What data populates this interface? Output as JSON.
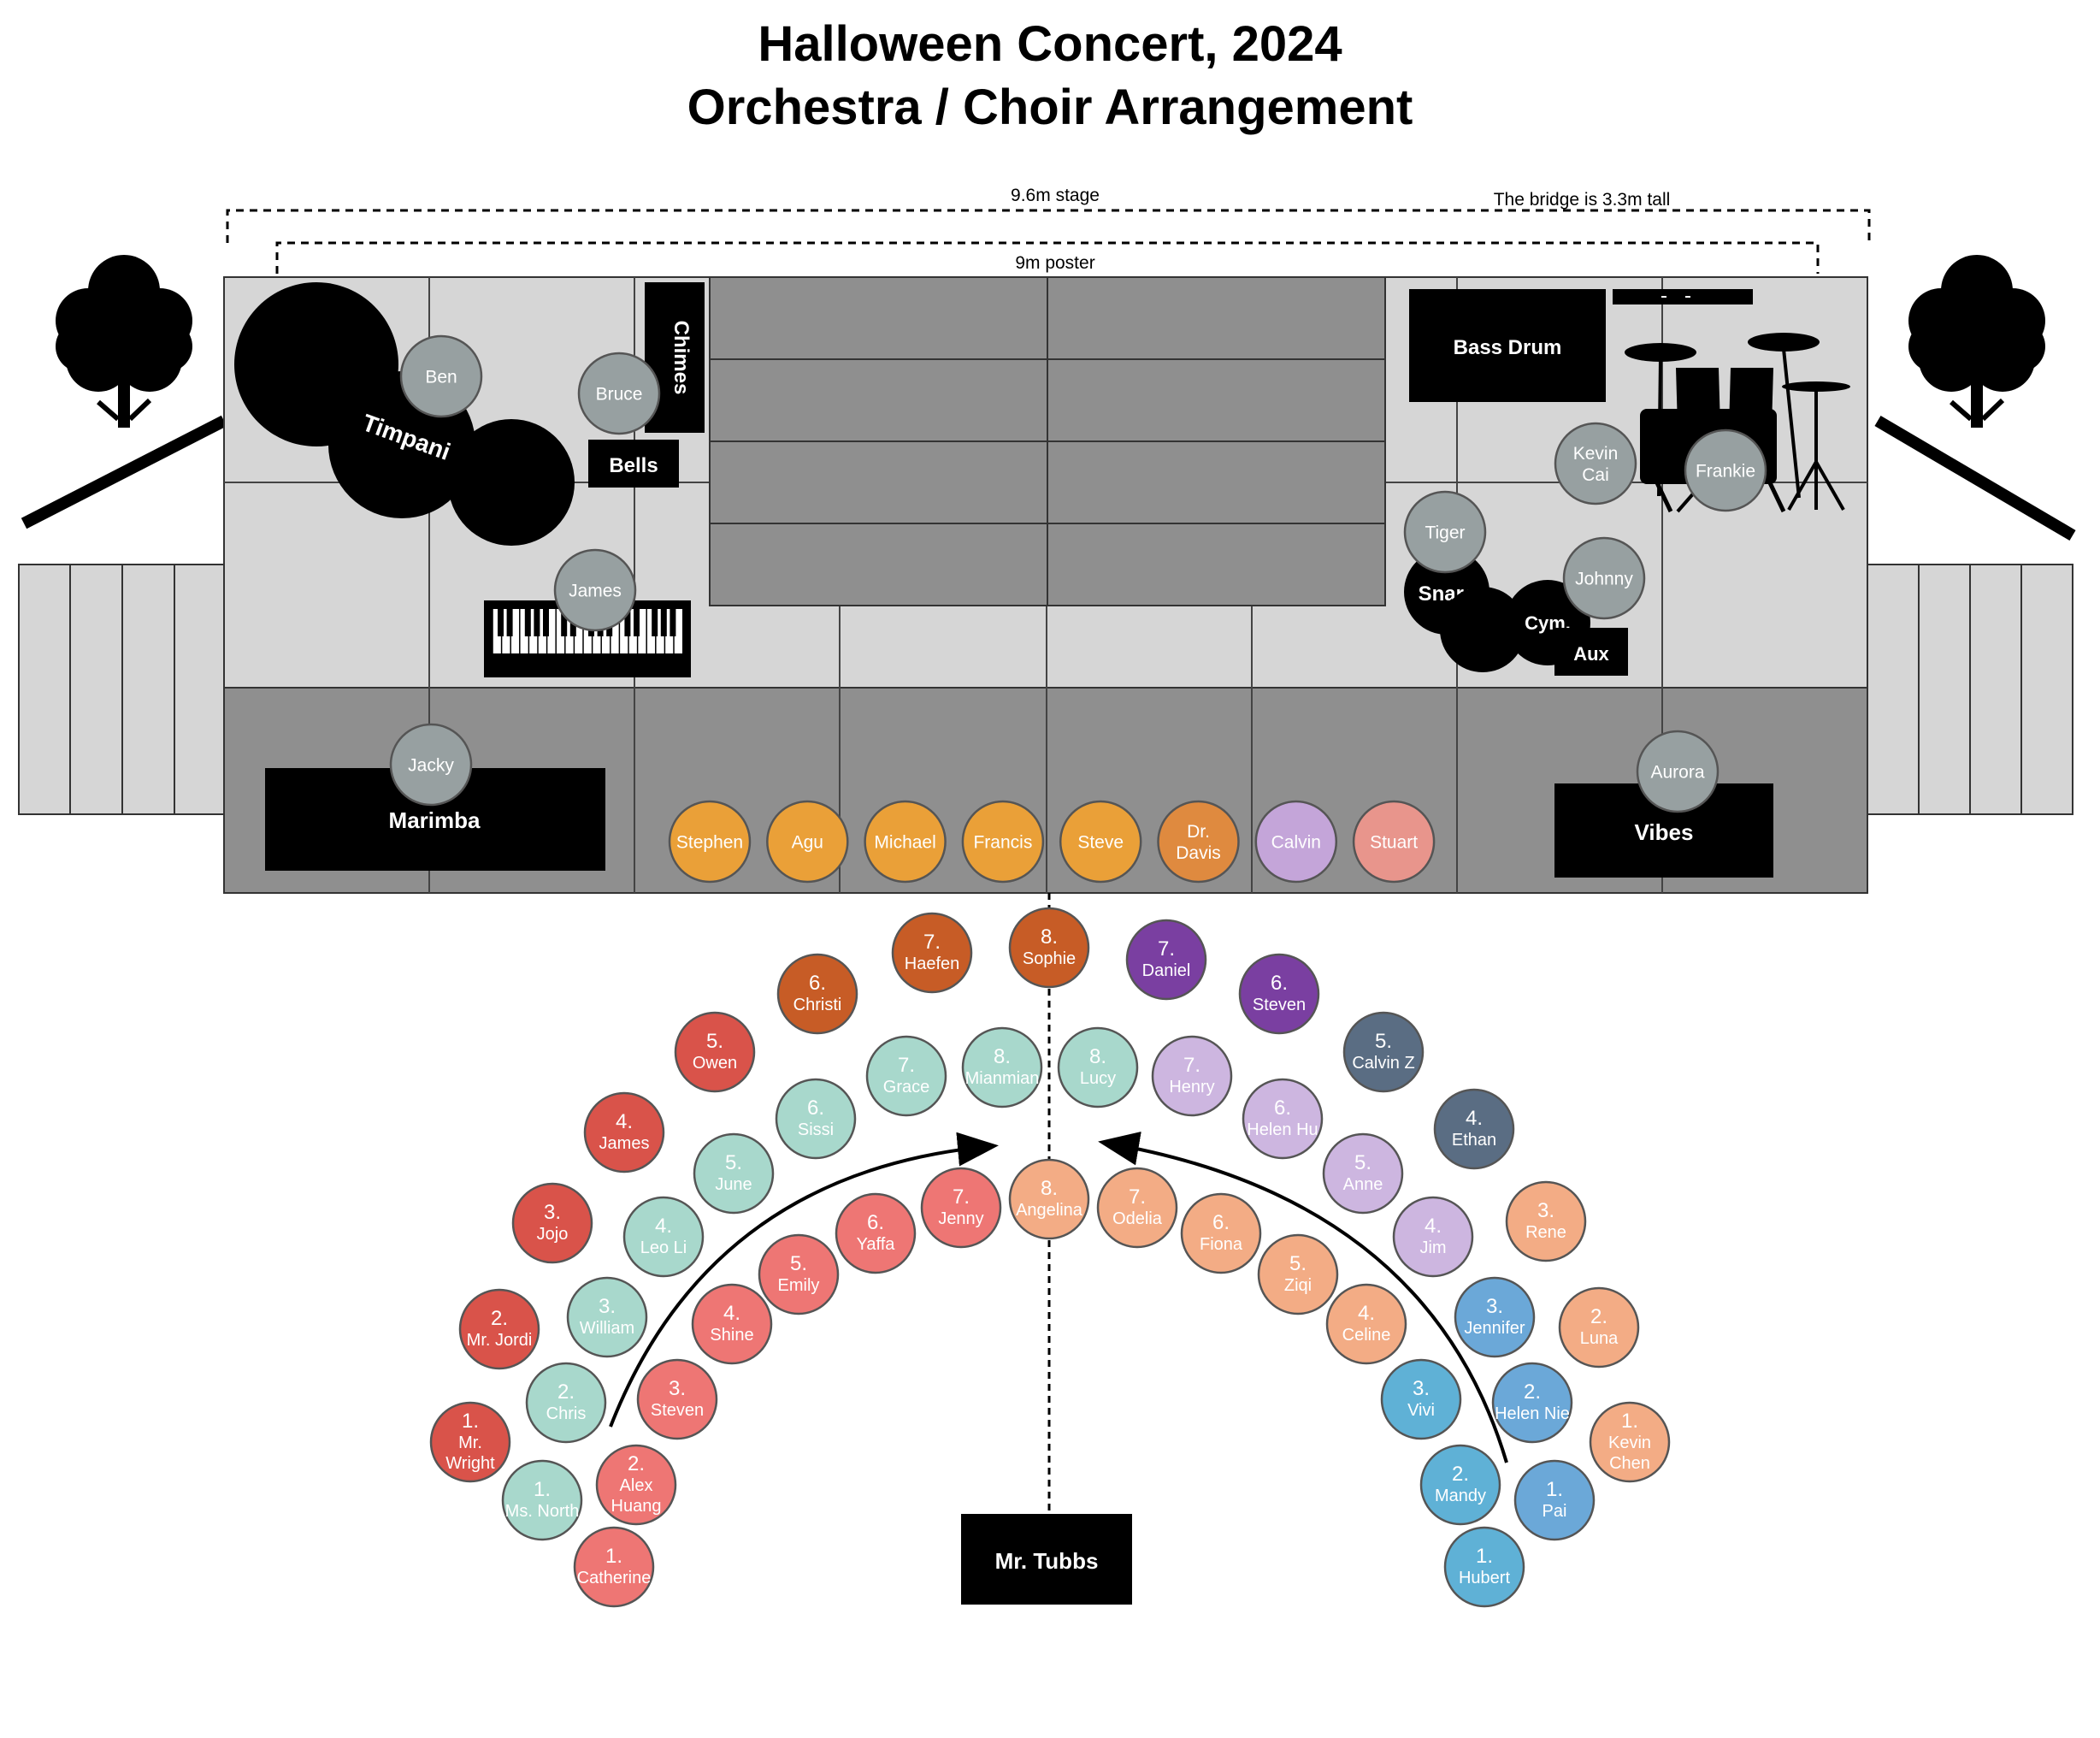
{
  "title_line1": "Halloween Concert, 2024",
  "title_line2": "Orchestra / Choir Arrangement",
  "annotations": {
    "stage_width": "9.6m stage",
    "bridge_height": "The bridge is 3.3m tall",
    "poster_width": "9m poster"
  },
  "instruments": {
    "timpani": "Timpani",
    "chimes": "Chimes",
    "bells": "Bells",
    "bass_drum": "Bass Drum",
    "snare": "Snare",
    "cymbal": "Cym.",
    "aux": "Aux",
    "marimba": "Marimba",
    "vibes": "Vibes"
  },
  "conductor": "Mr. Tubbs",
  "colors": {
    "stage_light": "#d6d6d6",
    "stage_dark": "#8f8f8f",
    "percussion_gray": "#97a0a1",
    "row_orange": "#eaa038",
    "dr_davis": "#df8a3f",
    "calvin": "#c4a5d9",
    "stuart": "#e8958c",
    "red": "#d9534a",
    "dark_orange": "#c75c26",
    "purple": "#7a3fa1",
    "slate": "#5a6d83",
    "mint": "#a8d8cc",
    "lavender": "#cdb6e0",
    "coral": "#ee7674",
    "peach": "#f3ac85",
    "blue": "#6ba8d8",
    "teal_blue": "#5fb1d6"
  },
  "percussionists": [
    {
      "name": "Ben"
    },
    {
      "name": "Bruce"
    },
    {
      "name": "James"
    },
    {
      "name": "Kevin\nCai"
    },
    {
      "name": "Frankie"
    },
    {
      "name": "Tiger"
    },
    {
      "name": "Johnny"
    },
    {
      "name": "Jacky"
    },
    {
      "name": "Aurora"
    }
  ],
  "front_row": [
    {
      "name": "Stephen",
      "color": "row_orange"
    },
    {
      "name": "Agu",
      "color": "row_orange"
    },
    {
      "name": "Michael",
      "color": "row_orange"
    },
    {
      "name": "Francis",
      "color": "row_orange"
    },
    {
      "name": "Steve",
      "color": "row_orange"
    },
    {
      "name": "Dr.\nDavis",
      "color": "dr_davis"
    },
    {
      "name": "Calvin",
      "color": "calvin"
    },
    {
      "name": "Stuart",
      "color": "stuart"
    }
  ],
  "choir": [
    {
      "num": "1.",
      "name": "Mr.\nWright",
      "color": "red"
    },
    {
      "num": "2.",
      "name": "Mr. Jordi",
      "color": "red"
    },
    {
      "num": "3.",
      "name": "Jojo",
      "color": "red"
    },
    {
      "num": "4.",
      "name": "James",
      "color": "red"
    },
    {
      "num": "5.",
      "name": "Owen",
      "color": "red"
    },
    {
      "num": "6.",
      "name": "Christi",
      "color": "dark_orange"
    },
    {
      "num": "7.",
      "name": "Haefen",
      "color": "dark_orange"
    },
    {
      "num": "8.",
      "name": "Sophie",
      "color": "dark_orange"
    },
    {
      "num": "7.",
      "name": "Daniel",
      "color": "purple"
    },
    {
      "num": "6.",
      "name": "Steven",
      "color": "purple"
    },
    {
      "num": "5.",
      "name": "Calvin Z",
      "color": "slate"
    },
    {
      "num": "4.",
      "name": "Ethan",
      "color": "slate"
    },
    {
      "num": "3.",
      "name": "Rene",
      "color": "peach"
    },
    {
      "num": "2.",
      "name": "Luna",
      "color": "peach"
    },
    {
      "num": "1.",
      "name": "Kevin\nChen",
      "color": "peach"
    },
    {
      "num": "1.",
      "name": "Ms. North",
      "color": "mint"
    },
    {
      "num": "2.",
      "name": "Chris",
      "color": "mint"
    },
    {
      "num": "3.",
      "name": "William",
      "color": "mint"
    },
    {
      "num": "4.",
      "name": "Leo Li",
      "color": "mint"
    },
    {
      "num": "5.",
      "name": "June",
      "color": "mint"
    },
    {
      "num": "6.",
      "name": "Sissi",
      "color": "mint"
    },
    {
      "num": "7.",
      "name": "Grace",
      "color": "mint"
    },
    {
      "num": "8.",
      "name": "Mianmian",
      "color": "mint"
    },
    {
      "num": "8.",
      "name": "Lucy",
      "color": "mint"
    },
    {
      "num": "7.",
      "name": "Henry",
      "color": "lavender"
    },
    {
      "num": "6.",
      "name": "Helen Hu",
      "color": "lavender"
    },
    {
      "num": "5.",
      "name": "Anne",
      "color": "lavender"
    },
    {
      "num": "4.",
      "name": "Jim",
      "color": "lavender"
    },
    {
      "num": "3.",
      "name": "Jennifer",
      "color": "blue"
    },
    {
      "num": "2.",
      "name": "Helen Nie",
      "color": "blue"
    },
    {
      "num": "1.",
      "name": "Pai",
      "color": "blue"
    },
    {
      "num": "1.",
      "name": "Catherine",
      "color": "coral"
    },
    {
      "num": "2.",
      "name": "Alex\nHuang",
      "color": "coral"
    },
    {
      "num": "3.",
      "name": "Steven",
      "color": "coral"
    },
    {
      "num": "4.",
      "name": "Shine",
      "color": "coral"
    },
    {
      "num": "5.",
      "name": "Emily",
      "color": "coral"
    },
    {
      "num": "6.",
      "name": "Yaffa",
      "color": "coral"
    },
    {
      "num": "7.",
      "name": "Jenny",
      "color": "coral"
    },
    {
      "num": "8.",
      "name": "Angelina",
      "color": "peach"
    },
    {
      "num": "7.",
      "name": "Odelia",
      "color": "peach"
    },
    {
      "num": "6.",
      "name": "Fiona",
      "color": "peach"
    },
    {
      "num": "5.",
      "name": "Ziqi",
      "color": "peach"
    },
    {
      "num": "4.",
      "name": "Celine",
      "color": "peach"
    },
    {
      "num": "3.",
      "name": "Vivi",
      "color": "teal_blue"
    },
    {
      "num": "2.",
      "name": "Mandy",
      "color": "teal_blue"
    },
    {
      "num": "1.",
      "name": "Hubert",
      "color": "teal_blue"
    }
  ]
}
